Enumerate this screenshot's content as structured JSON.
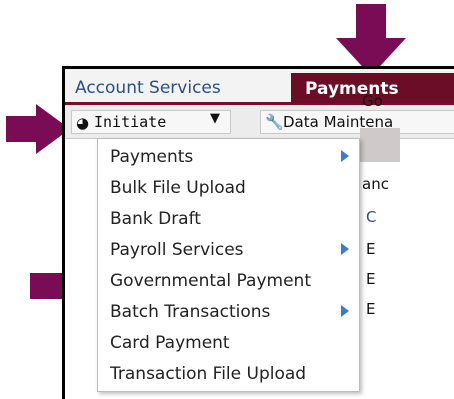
{
  "tabs": {
    "account_services": "Account Services",
    "payments": "Payments"
  },
  "toolbar": {
    "initiate": "Initiate",
    "data_maintenance": "Data Maintena"
  },
  "background": {
    "go": "Go",
    "an": "anc",
    "c": "C",
    "e1": "E",
    "e2": "E",
    "e3": "E"
  },
  "menu": {
    "items": [
      {
        "label": "Payments",
        "has_submenu": true
      },
      {
        "label": "Bulk File Upload",
        "has_submenu": false
      },
      {
        "label": "Bank Draft",
        "has_submenu": false
      },
      {
        "label": "Payroll Services",
        "has_submenu": true
      },
      {
        "label": "Governmental Payment",
        "has_submenu": false
      },
      {
        "label": "Batch Transactions",
        "has_submenu": true
      },
      {
        "label": "Card Payment",
        "has_submenu": false
      },
      {
        "label": "Transaction File Upload",
        "has_submenu": false
      }
    ]
  },
  "colors": {
    "brand": "#6b0d27",
    "arrow": "#7a0c56",
    "link": "#2a4f86",
    "submenu_arrow": "#3a7bd5"
  },
  "icons": {
    "initiate": "signal-icon",
    "maintenance": "wrench-icon",
    "dropdown": "caret-down-icon"
  }
}
